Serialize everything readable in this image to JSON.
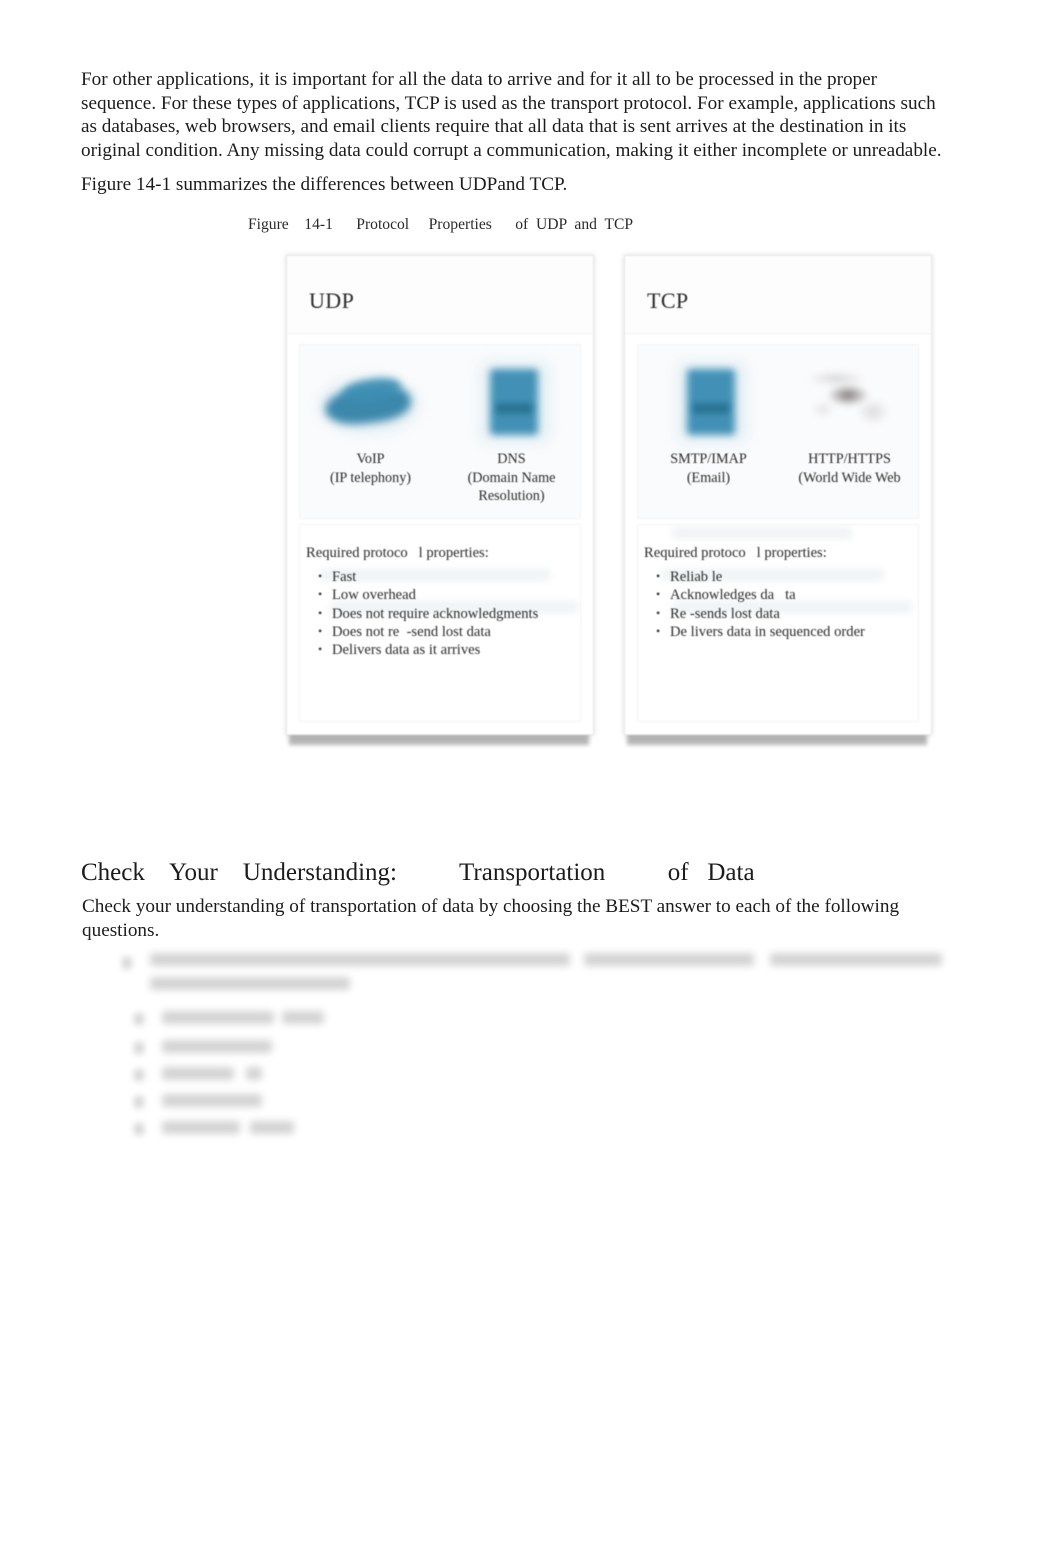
{
  "document": {
    "intro_paragraph": "For other applications, it is important for all the data to arrive and for it all to be processed in the proper sequence. For these types of applications, TCP is used as the transport protocol. For example, applications such as databases, web browsers, and email clients require that all data that is sent arrives at the destination in its original condition. Any missing data could corrupt a communication, making it either incomplete or unreadable.",
    "figure_reference": "Figure 14-1 summarizes the  differences  between  UDPand TCP."
  },
  "figure": {
    "caption": "Figure    14-1      Protocol     Properties      of  UDP  and  TCP",
    "cards": [
      {
        "title": "UDP",
        "applications": [
          {
            "name": "VoIP",
            "description": "(IP telephony)",
            "icon": "voip-phone-icon"
          },
          {
            "name": "DNS",
            "description": "(Domain Name Resolution)",
            "icon": "dns-server-icon"
          }
        ],
        "properties_title": "Required protoco   l properties:",
        "properties": [
          "Fast",
          "Low overhead",
          "Does not require acknowledgments",
          "Does not re  -send lost data",
          "Delivers data as it arrives"
        ]
      },
      {
        "title": "TCP",
        "applications": [
          {
            "name": "SMTP/IMAP",
            "description": "(Email)",
            "icon": "email-server-icon"
          },
          {
            "name": "HTTP/HTTPS",
            "description": "(World Wide Web",
            "icon": "globe-world-map-icon"
          }
        ],
        "properties_title": "Required protoco   l properties:",
        "properties": [
          "Reliab le",
          "Acknowledges da   ta",
          "Re -sends lost data",
          "De livers data in sequenced order"
        ]
      }
    ]
  },
  "section": {
    "heading": "Check    Your    Understanding:          Transportation          of   Data",
    "paragraph": "Check your understanding of transportation of data by choosing the BEST answer to each of the following questions."
  },
  "quiz": {
    "redacted": true,
    "question_lines": 2,
    "option_count": 5,
    "note": "Question and answer option text is blurred and illegible in the source image."
  },
  "colors": {
    "icon_blue": "#3a8cb3",
    "icon_blue_dark": "#26708f",
    "text": "#1c1c1c",
    "card_border": "#e9e9e9",
    "card_shadow": "#a8a8a8"
  }
}
